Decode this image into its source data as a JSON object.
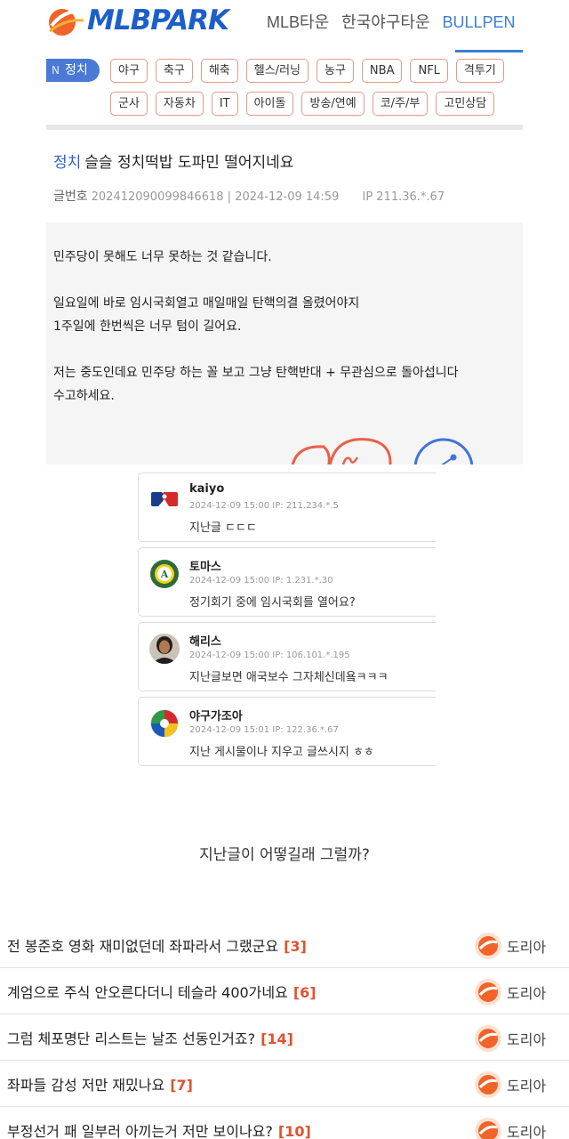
{
  "header": {
    "logo_text": "MLBPARK",
    "nav": [
      "MLB타운",
      "한국야구타운",
      "BULLPEN"
    ],
    "active_nav": "BULLPEN",
    "category_badge": {
      "letter": "N",
      "label": "정치"
    },
    "chips_row1": [
      "야구",
      "축구",
      "해축",
      "헬스/러닝",
      "농구",
      "NBA",
      "NFL",
      "격투기"
    ],
    "chips_row2": [
      "군사",
      "자동차",
      "IT",
      "아이돌",
      "방송/연예",
      "코/주/부",
      "고민상담"
    ]
  },
  "post": {
    "category": "정치",
    "title": "슬슬 정치떡밥 도파민 떨어지네요",
    "meta_label": "글번호",
    "post_no": "202412090099846618",
    "datetime": "2024-12-09 14:59",
    "ip": "IP 211.36.*.67",
    "body": [
      "민주당이 못해도 너무 못하는 것 같습니다.",
      "일요일에 바로 임시국회열고 매일매일 탄핵의결 올렸어야지",
      "1주일에 한번씩은 너무 텀이 길어요.",
      "저는 중도인데요 민주당 하는 꼴 보고 그냥 탄핵반대 + 무관심으로 돌아섭니다",
      "수고하세요."
    ]
  },
  "comments": [
    {
      "name": "kaiyo",
      "meta": "2024-12-09 15:00 IP: 211.234.*.5",
      "text": "지난글 ㄷㄷㄷ",
      "avatar": "mlb-logo-icon"
    },
    {
      "name": "토마스",
      "meta": "2024-12-09 15:00 IP: 1.231.*.30",
      "text": "정기회기 중에 임시국회를 열어요?",
      "avatar": "athletics-logo-icon"
    },
    {
      "name": "해리스",
      "meta": "2024-12-09 15:00 IP: 106.101.*.195",
      "text": "지난글보면 애국보수 그자체신데욬ㅋㅋㅋ",
      "avatar": "person-photo-icon"
    },
    {
      "name": "야구가조아",
      "meta": "2024-12-09 15:01 IP: 122.36.*.67",
      "text": "지난 게시물이나 지우고 글쓰시지 ㅎㅎ",
      "avatar": "wbc-logo-icon"
    }
  ],
  "caption": "지난글이 어떻길래 그럴까?",
  "related": [
    {
      "title": "전 봉준호 영화 재미없던데 좌파라서 그랬군요",
      "count": "[3]",
      "author": "도리아"
    },
    {
      "title": "계엄으로 주식 안오른다더니 테슬라 400가네요",
      "count": "[6]",
      "author": "도리아"
    },
    {
      "title": "그럼 체포명단 리스트는 날조 선동인거죠?",
      "count": "[14]",
      "author": "도리아"
    },
    {
      "title": "좌파들 감성 저만 재밌나요",
      "count": "[7]",
      "author": "도리아"
    },
    {
      "title": "부정선거 패 일부러 아끼는거 저만 보이나요?",
      "count": "[10]",
      "author": "도리아"
    }
  ],
  "colors": {
    "brand_blue": "#1d5fc9",
    "accent_orange": "#f0642a",
    "chip_border": "#e59a8a",
    "count_red": "#e0522f"
  }
}
